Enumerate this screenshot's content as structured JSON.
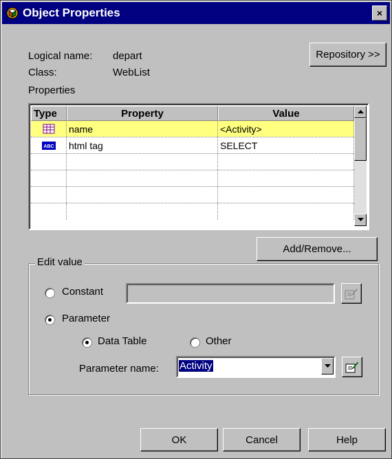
{
  "window": {
    "title": "Object Properties",
    "close": "×"
  },
  "info": {
    "logical_name_label": "Logical name:",
    "logical_name_value": "depart",
    "class_label": "Class:",
    "class_value": "WebList",
    "properties_label": "Properties"
  },
  "repository_button": "Repository >>",
  "table": {
    "columns": [
      "Type",
      "Property",
      "Value"
    ],
    "rows": [
      {
        "type_icon": "table-icon",
        "property": "name",
        "value": "<Activity>",
        "selected": true
      },
      {
        "type_icon": "abc-icon",
        "property": "html tag",
        "value": "SELECT",
        "selected": false
      },
      {
        "type_icon": "",
        "property": "",
        "value": ""
      },
      {
        "type_icon": "",
        "property": "",
        "value": ""
      },
      {
        "type_icon": "",
        "property": "",
        "value": ""
      },
      {
        "type_icon": "",
        "property": "",
        "value": ""
      }
    ]
  },
  "add_remove_button": "Add/Remove...",
  "edit_value": {
    "group_title": "Edit value",
    "constant_label": "Constant",
    "parameter_label": "Parameter",
    "data_table_label": "Data Table",
    "other_label": "Other",
    "parameter_name_label": "Parameter name:",
    "parameter_name_value": "Activity"
  },
  "buttons": {
    "ok": "OK",
    "cancel": "Cancel",
    "help": "Help"
  }
}
